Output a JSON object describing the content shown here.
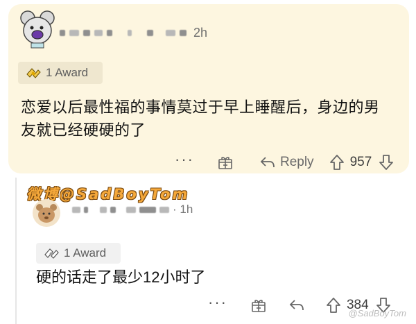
{
  "comment1": {
    "time": "2h",
    "award_label": "1 Award",
    "text": "恋爱以后最性福的事情莫过于早上睡醒后，身边的男友就已经硬硬的了",
    "actions": {
      "more": "···",
      "reply_label": "Reply",
      "score": "957"
    }
  },
  "comment2": {
    "watermark": "微博@SadBoyTom",
    "time": "1h",
    "award_label": "1 Award",
    "text": "硬的话走了最少12小时了",
    "actions": {
      "more": "···",
      "score": "384"
    },
    "corner_watermark": "@SadBoyTom"
  }
}
